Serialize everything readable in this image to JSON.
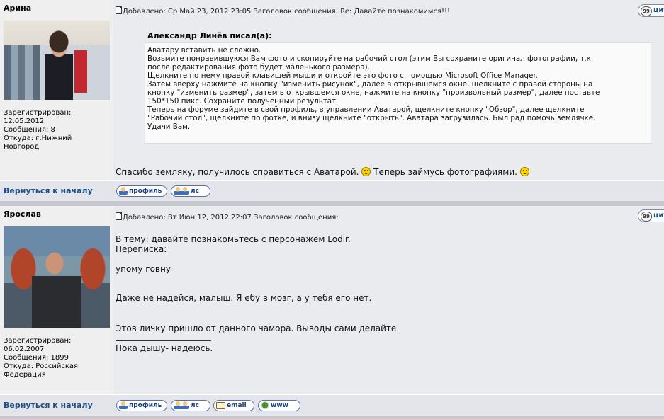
{
  "posts": [
    {
      "author": "Арина",
      "info": [
        "Зарегистрирован:",
        "12.05.2012",
        "Сообщения: 8",
        "Откуда: г.Нижний",
        "Новгород"
      ],
      "header": "Добавлено: Ср Май 23, 2012 23:05     Заголовок сообщения: Re: Давайте познакомимся!!!",
      "quote_author": "Александр Линёв писал(а):",
      "quote_lines": [
        "Аватару вставить не сложно.",
        "Возьмите понравившуюся Вам фото и скопируйте на рабочий стол (этим Вы сохраните оригинал фотографии, т.к.",
        "после редактирования фото будет маленького размера).",
        "Щелкните по нему правой клавишей мыши и откройте это фото с помощью Microsoft Office Manager.",
        "Затем вверху нажмите на кнопку \"изменить рисунок\", далее в открывшемся окне, щелкните с правой стороны на",
        "кнопку \"изменить размер\", затем в открывшемся окне, нажмите на кнопку \"произвольный размер\", далее поставте",
        "150*150 пикс. Сохраните полученный результат.",
        "Теперь на форуме зайдите в свой профиль, в управлении Аватарой, щелкните кнопку \"Обзор\", далее щелкните",
        "\"Рабочий стол\", щелкните по фотке, и внизу щелкните \"открыть\". Аватара загрузилась. Был рад помочь землячке.",
        "Удачи Вам."
      ],
      "body_part1": "Спасибо земляку, получилось справиться с Аватарой.",
      "body_part2": "Теперь займусь фотографиями.",
      "back_link": "Вернуться к началу",
      "buttons": [
        "профиль",
        "лс"
      ]
    },
    {
      "author": "Ярослав",
      "info": [
        "Зарегистрирован:",
        "06.02.2007",
        "Сообщения: 1899",
        "Откуда: Российская",
        "Федерация"
      ],
      "header": "Добавлено: Вт Июн 12, 2012 22:07     Заголовок сообщения:",
      "body_lines": [
        "В тему: давайте познакомьтесь с персонажем Lodir.",
        "Переписка:",
        "упому говну",
        "Даже не надейся, малыш. Я ебу в мозг, а у тебя его нет.",
        "Этов личку пришло от данного чамора. Выводы сами делайте.",
        "Пока дышу- надеюсь."
      ],
      "back_link": "Вернуться к началу",
      "buttons": [
        "профиль",
        "лс",
        "email",
        "www"
      ]
    }
  ],
  "quote_button_label": "цит",
  "quote_button_icon_text": "99"
}
